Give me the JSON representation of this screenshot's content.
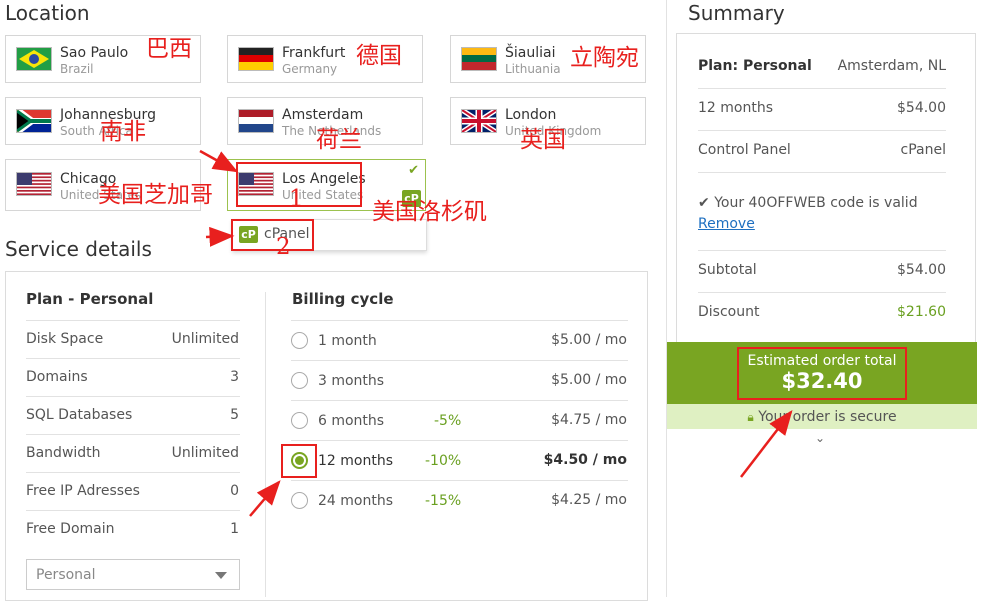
{
  "location": {
    "title": "Location",
    "cards": [
      {
        "name": "Sao Paulo",
        "country": "Brazil",
        "flag": "brazil-flag"
      },
      {
        "name": "Frankfurt",
        "country": "Germany",
        "flag": "germany-flag"
      },
      {
        "name": "Šiauliai",
        "country": "Lithuania",
        "flag": "lithuania-flag"
      },
      {
        "name": "Johannesburg",
        "country": "South Africa",
        "flag": "south-africa-flag"
      },
      {
        "name": "Amsterdam",
        "country": "The Netherlands",
        "flag": "netherlands-flag"
      },
      {
        "name": "London",
        "country": "United Kingdom",
        "flag": "uk-flag"
      },
      {
        "name": "Chicago",
        "country": "United States",
        "flag": "us-flag"
      },
      {
        "name": "Los Angeles",
        "country": "United States",
        "flag": "us-flag",
        "selected": true
      }
    ],
    "cpanel_badge": "cP",
    "cpanel_popup_label": "cPanel"
  },
  "annotations": {
    "brazil": "巴西",
    "germany": "德国",
    "lithuania": "立陶宛",
    "south_africa": "南非",
    "netherlands": "荷兰",
    "uk": "英国",
    "chicago": "美国芝加哥",
    "los_angeles": "美国洛杉矶",
    "num1": "1",
    "num2": "2",
    "accent_red": "#e8201e"
  },
  "service": {
    "title": "Service details",
    "plan_title": "Plan - Personal",
    "plan_rows": [
      {
        "label": "Disk Space",
        "value": "Unlimited"
      },
      {
        "label": "Domains",
        "value": "3"
      },
      {
        "label": "SQL Databases",
        "value": "5"
      },
      {
        "label": "Bandwidth",
        "value": "Unlimited"
      },
      {
        "label": "Free IP Adresses",
        "value": "0"
      },
      {
        "label": "Free Domain",
        "value": "1"
      }
    ],
    "plan_select": "Personal",
    "billing_title": "Billing cycle",
    "billing_rows": [
      {
        "label": "1 month",
        "discount": "",
        "price": "$5.00 / mo"
      },
      {
        "label": "3 months",
        "discount": "",
        "price": "$5.00 / mo"
      },
      {
        "label": "6 months",
        "discount": "-5%",
        "price": "$4.75 / mo"
      },
      {
        "label": "12 months",
        "discount": "-10%",
        "price": "$4.50 / mo",
        "selected": true
      },
      {
        "label": "24 months",
        "discount": "-15%",
        "price": "$4.25 / mo"
      }
    ]
  },
  "summary": {
    "title": "Summary",
    "plan_label": "Plan: Personal",
    "plan_location": "Amsterdam, NL",
    "period_label": "12 months",
    "period_price": "$54.00",
    "control_panel_label": "Control Panel",
    "control_panel_value": "cPanel",
    "coupon_text": "Your 40OFFWEB code is valid",
    "remove_link": "Remove",
    "subtotal_label": "Subtotal",
    "subtotal_value": "$54.00",
    "discount_label": "Discount",
    "discount_value": "$21.60",
    "total_label": "Estimated order total",
    "total_value": "$32.40",
    "secure_text": "Your order is secure",
    "accent_green": "#79a522"
  }
}
